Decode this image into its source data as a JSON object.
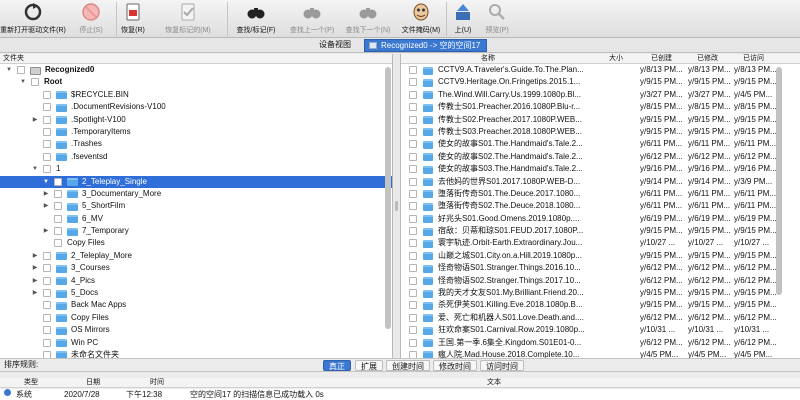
{
  "toolbar": {
    "buttons": [
      {
        "label": "重新打开驱动文件(R)",
        "icon": "refresh-icon"
      },
      {
        "label": "停止(S)",
        "icon": "stop-icon"
      },
      {
        "label": "恢复(R)",
        "icon": "recover-icon"
      },
      {
        "label": "恢复标记的(M)",
        "icon": "recover-marked-icon"
      },
      {
        "label": "查找/标记(F)",
        "icon": "binoculars-icon"
      },
      {
        "label": "查找上一个(P)",
        "icon": "find-previous-icon"
      },
      {
        "label": "查找下一个(N)",
        "icon": "find-next-icon"
      },
      {
        "label": "文件掩码(M)",
        "icon": "file-mask-icon"
      },
      {
        "label": "上(U)",
        "icon": "up-icon"
      },
      {
        "label": "预览(P)",
        "icon": "preview-icon"
      }
    ]
  },
  "tabs": {
    "device_view": "设备视图",
    "active": "Recognized0 -> 空的空间17"
  },
  "left": {
    "header": "文件夹",
    "tree": [
      {
        "label": "Recognized0",
        "bold": true
      },
      {
        "label": "Root",
        "bold": true
      },
      {
        "label": "$RECYCLE.BIN"
      },
      {
        "label": ".DocumentRevisions-V100"
      },
      {
        "label": ".Spotlight-V100"
      },
      {
        "label": ".TemporaryItems"
      },
      {
        "label": ".Trashes"
      },
      {
        "label": ".fseventsd"
      },
      {
        "label": "1"
      },
      {
        "label": "2_Teleplay_Single"
      },
      {
        "label": "3_Documentary_More"
      },
      {
        "label": "5_ShortFilm"
      },
      {
        "label": "6_MV"
      },
      {
        "label": "7_Temporary"
      },
      {
        "label": "Copy Files"
      },
      {
        "label": "2_Teleplay_More"
      },
      {
        "label": "3_Courses"
      },
      {
        "label": "4_Pics"
      },
      {
        "label": "5_Docs"
      },
      {
        "label": "Back Mac Apps"
      },
      {
        "label": "Copy Files"
      },
      {
        "label": "OS Mirrors"
      },
      {
        "label": "Win PC"
      },
      {
        "label": "未命名文件夹"
      }
    ]
  },
  "right": {
    "columns": {
      "name": "名称",
      "size": "大小",
      "created": "已创建",
      "modified": "已修改",
      "accessed": "已访问"
    },
    "files": [
      {
        "name": "CCTV9.A.Traveler's.Guide.To.The.Plan...",
        "created": "y/8/13 PM...",
        "modified": "y/8/13 PM...",
        "accessed": "y/8/13 PM..."
      },
      {
        "name": "CCTV9.Heritage.On.Fringetips.2015.1...",
        "created": "y/9/15 PM...",
        "modified": "y/9/15 PM...",
        "accessed": "y/9/15 PM..."
      },
      {
        "name": "The.Wind.Will.Carry.Us.1999.1080p.Bl...",
        "created": "y/3/27 PM...",
        "modified": "y/3/27 PM...",
        "accessed": "y/4/5 PM..."
      },
      {
        "name": "传教士S01.Preacher.2016.1080P.Blu-r...",
        "created": "y/8/15 PM...",
        "modified": "y/8/15 PM...",
        "accessed": "y/8/15 PM..."
      },
      {
        "name": "传教士S02.Preacher.2017.1080P.WEB...",
        "created": "y/9/15 PM...",
        "modified": "y/9/15 PM...",
        "accessed": "y/9/15 PM..."
      },
      {
        "name": "传教士S03.Preacher.2018.1080P.WEB...",
        "created": "y/9/15 PM...",
        "modified": "y/9/15 PM...",
        "accessed": "y/9/15 PM..."
      },
      {
        "name": "使女的故事S01.The.Handmaid's.Tale.2...",
        "created": "y/6/11 PM...",
        "modified": "y/6/11 PM...",
        "accessed": "y/6/11 PM..."
      },
      {
        "name": "使女的故事S02.The.Handmaid's.Tale.2...",
        "created": "y/6/12 PM...",
        "modified": "y/6/12 PM...",
        "accessed": "y/6/12 PM..."
      },
      {
        "name": "使女的故事S03.The.Handmaid's.Tale.2...",
        "created": "y/9/16 PM...",
        "modified": "y/9/16 PM...",
        "accessed": "y/9/16 PM..."
      },
      {
        "name": "去他妈的世界S01.2017.1080P.WEB-D...",
        "created": "y/9/14 PM...",
        "modified": "y/9/14 PM...",
        "accessed": "y/3/9 PM..."
      },
      {
        "name": "堕落街传奇S01.The.Deuce.2017.1080...",
        "created": "y/6/11 PM...",
        "modified": "y/6/11 PM...",
        "accessed": "y/6/11 PM..."
      },
      {
        "name": "堕落街传奇S02.The.Deuce.2018.1080...",
        "created": "y/6/11 PM...",
        "modified": "y/6/11 PM...",
        "accessed": "y/6/11 PM..."
      },
      {
        "name": "好兆头S01.Good.Omens.2019.1080p....",
        "created": "y/6/19 PM...",
        "modified": "y/6/19 PM...",
        "accessed": "y/6/19 PM..."
      },
      {
        "name": "宿敌：贝蒂和琼S01.FEUD.2017.1080P...",
        "created": "y/9/15 PM...",
        "modified": "y/9/15 PM...",
        "accessed": "y/9/15 PM..."
      },
      {
        "name": "寰宇轨迹.Orbit-Earth.Extraordinary.Jou...",
        "created": "y/10/27 ...",
        "modified": "y/10/27 ...",
        "accessed": "y/10/27 ..."
      },
      {
        "name": "山巅之城S01.City.on.a.Hill.2019.1080p...",
        "created": "y/9/15 PM...",
        "modified": "y/9/15 PM...",
        "accessed": "y/9/15 PM..."
      },
      {
        "name": "怪奇物语S01.Stranger.Things.2016.10...",
        "created": "y/6/12 PM...",
        "modified": "y/6/12 PM...",
        "accessed": "y/6/12 PM..."
      },
      {
        "name": "怪奇物语S02.Stranger.Things.2017.10...",
        "created": "y/6/12 PM...",
        "modified": "y/6/12 PM...",
        "accessed": "y/6/12 PM..."
      },
      {
        "name": "我的天才女友S01.My.Brilliant.Friend.20...",
        "created": "y/9/15 PM...",
        "modified": "y/9/15 PM...",
        "accessed": "y/9/15 PM..."
      },
      {
        "name": "杀死伊芙S01.Killing.Eve.2018.1080p.B...",
        "created": "y/9/15 PM...",
        "modified": "y/9/15 PM...",
        "accessed": "y/9/15 PM..."
      },
      {
        "name": "爱、死亡和机器人S01.Love.Death.and....",
        "created": "y/6/12 PM...",
        "modified": "y/6/12 PM...",
        "accessed": "y/6/12 PM..."
      },
      {
        "name": "狂欢命案S01.Carnival.Row.2019.1080p...",
        "created": "y/10/31 ...",
        "modified": "y/10/31 ...",
        "accessed": "y/10/31 ..."
      },
      {
        "name": "王国.第一季.6集全.Kingdom.S01E01-0...",
        "created": "y/6/12 PM...",
        "modified": "y/6/12 PM...",
        "accessed": "y/6/12 PM..."
      },
      {
        "name": "瘋人院.Mad.House.2018.Complete.10...",
        "created": "y/4/5 PM...",
        "modified": "y/4/5 PM...",
        "accessed": "y/4/5 PM..."
      }
    ]
  },
  "sortbar": {
    "label": "排序规则:",
    "buttons": [
      "真正",
      "扩展",
      "创建时间",
      "修改时间",
      "访问时间"
    ]
  },
  "log": {
    "columns": {
      "type": "类型",
      "date": "日期",
      "time": "时间",
      "text": "文本"
    },
    "rows": [
      {
        "type": "系统",
        "date": "2020/7/28",
        "time": "下午12:38",
        "text": "空的空间17 的扫描信息已成功载入 0s"
      }
    ]
  },
  "colors": {
    "accent": "#3a78d2",
    "selection": "#2f6ed8",
    "folder": "#56a8e8"
  }
}
